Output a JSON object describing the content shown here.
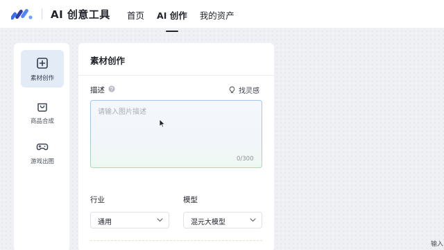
{
  "header": {
    "title": "AI 创意工具",
    "nav": [
      {
        "label": "首页"
      },
      {
        "label": "AI 创作"
      },
      {
        "label": "我的资产"
      }
    ]
  },
  "sidebar": {
    "items": [
      {
        "label": "素材创作",
        "icon": "plus-square-icon",
        "active": true
      },
      {
        "label": "商品合成",
        "icon": "shopping-bag-icon",
        "active": false
      },
      {
        "label": "游戏出图",
        "icon": "gamepad-icon",
        "active": false
      }
    ]
  },
  "panel": {
    "title": "素材创作",
    "description": {
      "label": "描述",
      "inspire_label": "找灵感",
      "placeholder": "请输入图片描述",
      "value": "",
      "counter": "0/300"
    },
    "industry": {
      "label": "行业",
      "selected": "通用"
    },
    "model": {
      "label": "模型",
      "selected": "混元大模型"
    }
  },
  "corner_text": "输入",
  "colors": {
    "accent_bg": "#e3ebf7",
    "icon_dark": "#3b4351",
    "logo_blue": "#3a6ff5",
    "logo_navy": "#2f3ea8"
  }
}
